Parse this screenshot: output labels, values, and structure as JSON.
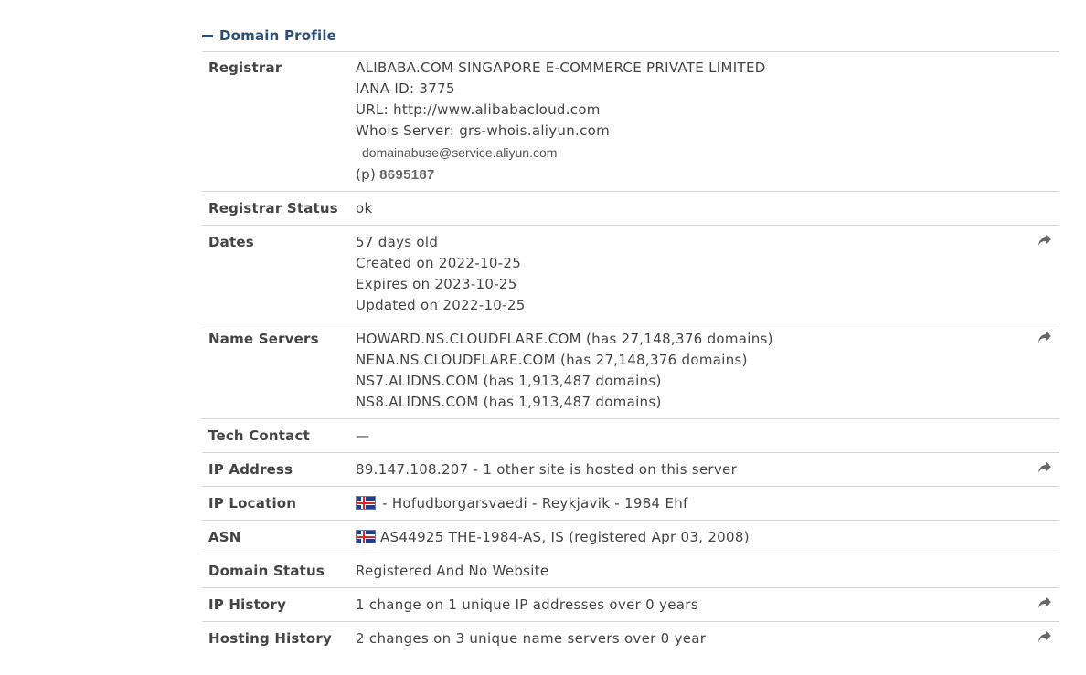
{
  "panel": {
    "title": "Domain Profile",
    "collapse_icon": "minus-icon"
  },
  "registrar": {
    "label": "Registrar",
    "name": "ALIBABA.COM SINGAPORE E-COMMERCE PRIVATE LIMITED",
    "iana": "IANA ID: 3775",
    "url": "URL: http://www.alibabacloud.com",
    "whois": "Whois Server: grs-whois.aliyun.com",
    "email": "domainabuse@service.aliyun.com",
    "phone_prefix": "(p)",
    "phone": "8695187"
  },
  "registrar_status": {
    "label": "Registrar Status",
    "value": "ok"
  },
  "dates": {
    "label": "Dates",
    "lines": [
      "57 days old",
      "Created on 2022-10-25",
      "Expires on 2023-10-25",
      "Updated on 2022-10-25"
    ]
  },
  "name_servers": {
    "label": "Name Servers",
    "lines": [
      "HOWARD.NS.CLOUDFLARE.COM (has 27,148,376 domains)",
      "NENA.NS.CLOUDFLARE.COM (has 27,148,376 domains)",
      "NS7.ALIDNS.COM (has 1,913,487 domains)",
      "NS8.ALIDNS.COM (has 1,913,487 domains)"
    ]
  },
  "tech_contact": {
    "label": "Tech Contact",
    "value": "—"
  },
  "ip_address": {
    "label": "IP Address",
    "value": "89.147.108.207 - 1 other site is hosted on this server"
  },
  "ip_location": {
    "label": "IP Location",
    "value": " - Hofudborgarsvaedi - Reykjavik - 1984 Ehf"
  },
  "asn": {
    "label": "ASN",
    "value": "AS44925 THE-1984-AS, IS (registered Apr 03, 2008)"
  },
  "domain_status": {
    "label": "Domain Status",
    "value": "Registered And No Website"
  },
  "ip_history": {
    "label": "IP History",
    "value": "1 change on 1 unique IP addresses over 0 years"
  },
  "hosting_history": {
    "label": "Hosting History",
    "value": "2 changes on 3 unique name servers over 0 year"
  },
  "icons": {
    "share": "share-arrow-icon",
    "flag": "iceland-flag-icon"
  },
  "colors": {
    "header_text": "#2e4f75",
    "body_text": "#444444",
    "divider": "#d6d6d6",
    "icon": "#666666"
  }
}
